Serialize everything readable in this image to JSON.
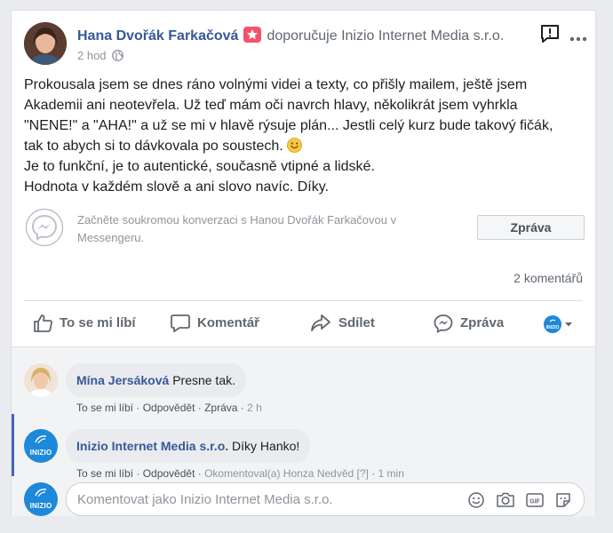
{
  "post": {
    "author": "Hana Dvořák Farkačová",
    "recommends_text": "doporučuje",
    "page_name": "Inizio Internet Media s.r.o.",
    "time": "2 hod",
    "lines": [
      "Prokousala jsem se dnes ráno volnými videi a texty, co přišly mailem, ještě jsem",
      "Akademii ani neotevřela. Už teď mám oči navrch hlavy, několikrát jsem vyhrkla",
      "\"NENE!\" a \"AHA!\" a už se mi v hlavě rýsuje plán... Jestli celý kurz bude takový fičák,",
      "tak to abych si to dávkovala po soustech.",
      "Je to funkční, je to autentické, současně vtipné a lidské.",
      "Hodnota v každém slově a ani slovo navíc. Díky."
    ]
  },
  "messenger": {
    "prompt": "Začněte soukromou konverzaci s Hanou Dvořák Farkačovou v Messengeru.",
    "button": "Zpráva"
  },
  "comment_count": "2 komentářů",
  "actions": {
    "like": "To se mi líbí",
    "comment": "Komentář",
    "share": "Sdílet",
    "message": "Zpráva"
  },
  "comments": [
    {
      "author": "Mína Jersáková",
      "text": "Presne tak.",
      "like": "To se mi líbí",
      "reply": "Odpovědět",
      "message": "Zpráva",
      "time": "2 h"
    },
    {
      "author": "Inizio Internet Media s.r.o.",
      "text": "Díky Hanko!",
      "like": "To se mi líbí",
      "reply": "Odpovědět",
      "commented_by": "Okomentoval(a) Honza Nedvěd",
      "help": "[?]",
      "time": "1 min"
    }
  ],
  "page_avatar_label": "INIZIO",
  "compose": {
    "placeholder": "Komentovat jako Inizio Internet Media s.r.o."
  },
  "colors": {
    "link_blue": "#365899",
    "accent": "#4267b2",
    "inizio_blue": "#1e88d9"
  }
}
